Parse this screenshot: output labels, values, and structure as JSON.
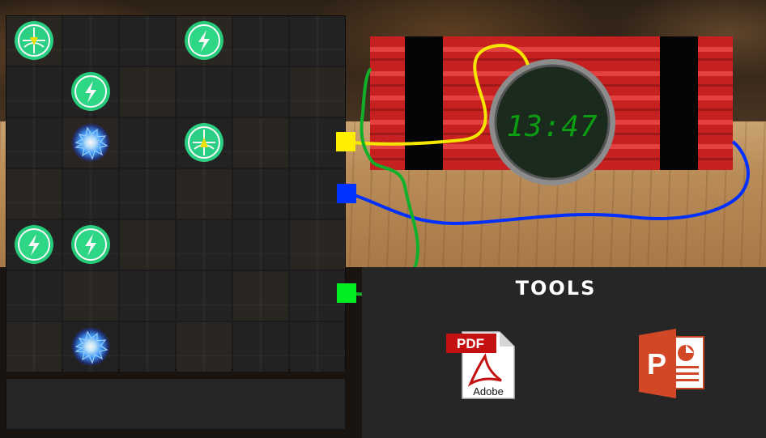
{
  "bomb": {
    "timer": "13:47"
  },
  "tools": {
    "title": "TOOLS",
    "items": [
      {
        "name": "pdf-tool",
        "label": "PDF",
        "brand": "Adobe"
      },
      {
        "name": "powerpoint-tool",
        "label": "P"
      }
    ]
  },
  "wires": [
    {
      "color": "#ffee00",
      "name": "yellow"
    },
    {
      "color": "#0033ff",
      "name": "blue"
    },
    {
      "color": "#00ee22",
      "name": "green"
    }
  ],
  "grid": {
    "rows": 7,
    "cols": 6,
    "components": [
      {
        "row": 0,
        "col": 0,
        "type": "splitter-down"
      },
      {
        "row": 0,
        "col": 3,
        "type": "bolt"
      },
      {
        "row": 1,
        "col": 1,
        "type": "bolt"
      },
      {
        "row": 2,
        "col": 1,
        "type": "spark"
      },
      {
        "row": 2,
        "col": 3,
        "type": "splitter-up"
      },
      {
        "row": 4,
        "col": 0,
        "type": "bolt"
      },
      {
        "row": 4,
        "col": 1,
        "type": "bolt"
      },
      {
        "row": 6,
        "col": 1,
        "type": "spark"
      }
    ]
  },
  "colors": {
    "bomb_red": "#d42a2a",
    "component_green": "#2ede8a",
    "timer_green": "#0c9d12"
  }
}
